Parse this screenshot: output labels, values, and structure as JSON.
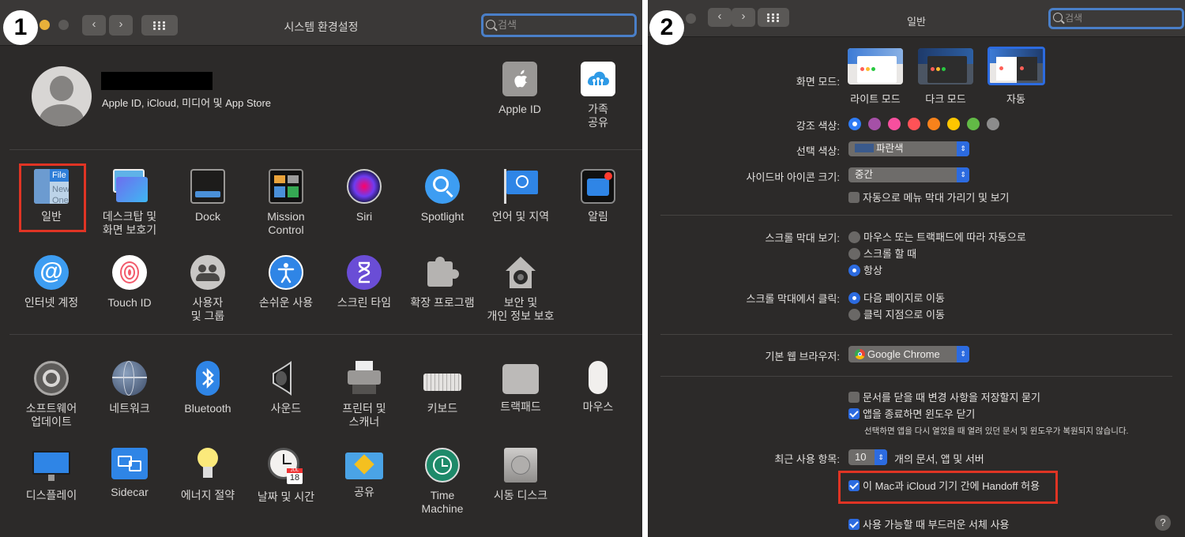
{
  "badges": {
    "left": "1",
    "right": "2"
  },
  "left": {
    "window_title": "시스템 환경설정",
    "search_placeholder": "검색",
    "account": {
      "name_redacted": "",
      "subtitle": "Apple ID, iCloud, 미디어 및 App Store",
      "apple_id_label": "Apple ID",
      "family_label": "가족\n공유"
    },
    "row1": [
      "일반",
      "데스크탑 및\n화면 보호기",
      "Dock",
      "Mission\nControl",
      "Siri",
      "Spotlight",
      "언어 및 지역",
      "알림"
    ],
    "row2": [
      "인터넷 계정",
      "Touch ID",
      "사용자\n및 그룹",
      "손쉬운 사용",
      "스크린 타임",
      "확장 프로그램",
      "보안 및\n개인 정보 보호"
    ],
    "row3": [
      "소프트웨어\n업데이트",
      "네트워크",
      "Bluetooth",
      "사운드",
      "프린터 및\n스캐너",
      "키보드",
      "트랙패드",
      "마우스"
    ],
    "row4": [
      "디스플레이",
      "Sidecar",
      "에너지 절약",
      "날짜 및 시간",
      "공유",
      "Time\nMachine",
      "시동 디스크"
    ],
    "general_icon_text": {
      "a": "File",
      "b": "New",
      "c": "One"
    },
    "calendar_text": {
      "month": "JUL",
      "day": "18"
    }
  },
  "right": {
    "window_title": "일반",
    "search_placeholder": "검색",
    "appearance": {
      "label": "화면 모드:",
      "options": [
        "라이트 모드",
        "다크 모드",
        "자동"
      ],
      "selected": "자동"
    },
    "accent": {
      "label": "강조 색상:",
      "colors": [
        "#2f7bf5",
        "#a550a7",
        "#f74f9e",
        "#ff5257",
        "#f7821b",
        "#ffc600",
        "#62ba46",
        "#8c8c8c"
      ],
      "selected_index": 0
    },
    "highlight": {
      "label": "선택 색상:",
      "value": "파란색",
      "swatch": "#3a5a8c"
    },
    "sidebar_icon": {
      "label": "사이드바 아이콘 크기:",
      "value": "중간"
    },
    "auto_hide_menu": {
      "label": "자동으로 메뉴 막대 가리기 및 보기",
      "checked": false
    },
    "scroll_show": {
      "label": "스크롤 막대 보기:",
      "options": [
        "마우스 또는 트랙패드에 따라 자동으로",
        "스크롤 할 때",
        "항상"
      ],
      "selected": "항상"
    },
    "scroll_click": {
      "label": "스크롤 막대에서 클릭:",
      "options": [
        "다음 페이지로 이동",
        "클릭 지점으로 이동"
      ],
      "selected": "다음 페이지로 이동"
    },
    "browser": {
      "label": "기본 웹 브라우저:",
      "value": "Google Chrome"
    },
    "ask_save": {
      "label": "문서를 닫을 때 변경 사항을 저장할지 묻기",
      "checked": false
    },
    "close_windows": {
      "label": "앱을 종료하면 윈도우 닫기",
      "checked": true
    },
    "close_windows_note": "선택하면 앱을 다시 열었을 때 열려 있던 문서 및 윈도우가 복원되지 않습니다.",
    "recent": {
      "label": "최근 사용 항목:",
      "value": "10",
      "suffix": "개의 문서, 앱 및 서버"
    },
    "handoff": {
      "label": "이 Mac과 iCloud 기기 간에 Handoff 허용",
      "checked": true
    },
    "font_smoothing": {
      "label": "사용 가능할 때 부드러운 서체 사용",
      "checked": true
    },
    "help": "?"
  },
  "colors": {
    "accent_blue": "#2c6be0",
    "highlight_red": "#e03424",
    "panel_bg": "#2c2a29"
  }
}
